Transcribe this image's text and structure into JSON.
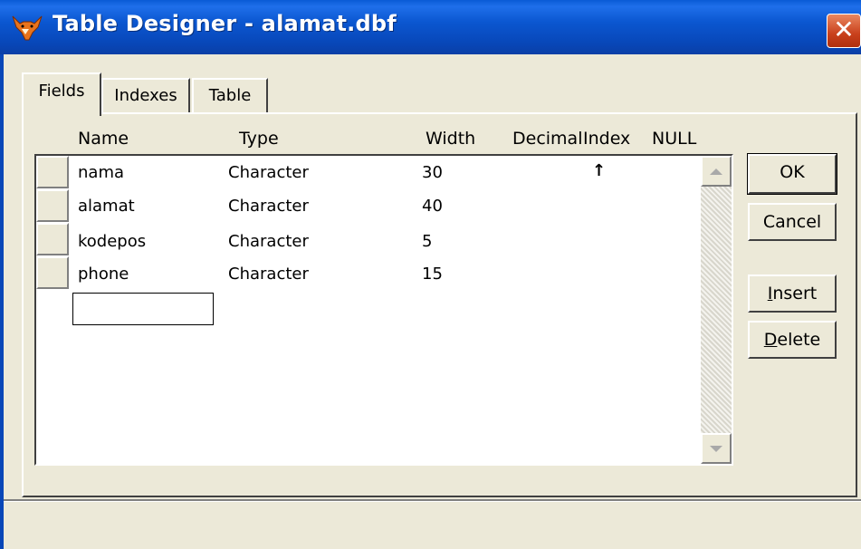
{
  "window": {
    "title": "Table Designer - alamat.dbf",
    "close_glyph": "✕",
    "icon": "foxpro-fox-icon"
  },
  "tabs": [
    {
      "label": "Fields",
      "active": true
    },
    {
      "label": "Indexes",
      "active": false
    },
    {
      "label": "Table",
      "active": false
    }
  ],
  "grid": {
    "headers": {
      "name": "Name",
      "type": "Type",
      "width": "Width",
      "decimal": "Decimal",
      "index": "Index",
      "null": "NULL"
    },
    "rows": [
      {
        "name": "nama",
        "type": "Character",
        "width": "30",
        "decimal": "",
        "index": "↑"
      },
      {
        "name": "alamat",
        "type": "Character",
        "width": "40",
        "decimal": "",
        "index": ""
      },
      {
        "name": "kodepos",
        "type": "Character",
        "width": "5",
        "decimal": "",
        "index": ""
      },
      {
        "name": "phone",
        "type": "Character",
        "width": "15",
        "decimal": "",
        "index": ""
      }
    ],
    "new_field_value": ""
  },
  "buttons": {
    "ok": "OK",
    "cancel": "Cancel",
    "insert_first": "I",
    "insert_rest": "nsert",
    "delete_first": "D",
    "delete_rest": "elete"
  },
  "colors": {
    "titlebar": "#0a5bd6",
    "close": "#c9401c",
    "face": "#ece9d8"
  }
}
